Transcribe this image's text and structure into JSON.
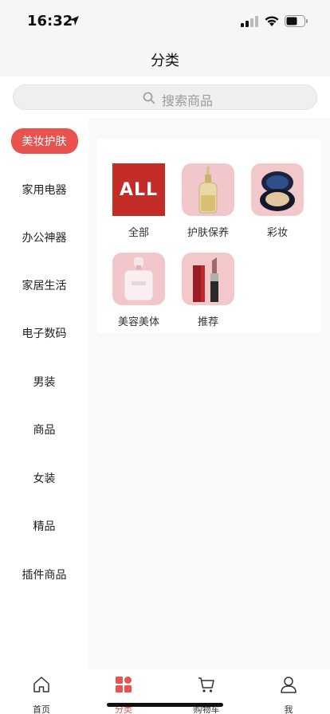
{
  "status_bar": {
    "time": "16:32",
    "location_icon": "location-arrow-icon",
    "signal_icon": "cellular-signal-icon",
    "wifi_icon": "wifi-icon",
    "battery_icon": "battery-icon"
  },
  "nav": {
    "title": "分类"
  },
  "search": {
    "placeholder": "搜索商品",
    "icon": "search-icon"
  },
  "sidebar": {
    "items": [
      {
        "label": "美妆护肤",
        "active": true
      },
      {
        "label": "家用电器",
        "active": false
      },
      {
        "label": "办公神器",
        "active": false
      },
      {
        "label": "家居生活",
        "active": false
      },
      {
        "label": "电子数码",
        "active": false
      },
      {
        "label": "男装",
        "active": false
      },
      {
        "label": "商品",
        "active": false
      },
      {
        "label": "女装",
        "active": false
      },
      {
        "label": "精品",
        "active": false
      },
      {
        "label": "插件商品",
        "active": false
      }
    ]
  },
  "categories": [
    {
      "label": "全部",
      "thumb_text": "ALL"
    },
    {
      "label": "护肤保养",
      "thumb": "serum-bottle"
    },
    {
      "label": "彩妆",
      "thumb": "cushion-compact"
    },
    {
      "label": "美容美体",
      "thumb": "perfume-bottle"
    },
    {
      "label": "推荐",
      "thumb": "lipstick"
    }
  ],
  "tab_bar": {
    "tabs": [
      {
        "label": "首页",
        "icon": "home-icon",
        "active": false
      },
      {
        "label": "分类",
        "icon": "category-icon",
        "active": true
      },
      {
        "label": "购物车",
        "icon": "cart-icon",
        "active": false
      },
      {
        "label": "我",
        "icon": "user-icon",
        "active": false
      }
    ]
  },
  "colors": {
    "accent": "#e8524f",
    "all_tile": "#c42c27",
    "background": "#f6f6f6"
  }
}
